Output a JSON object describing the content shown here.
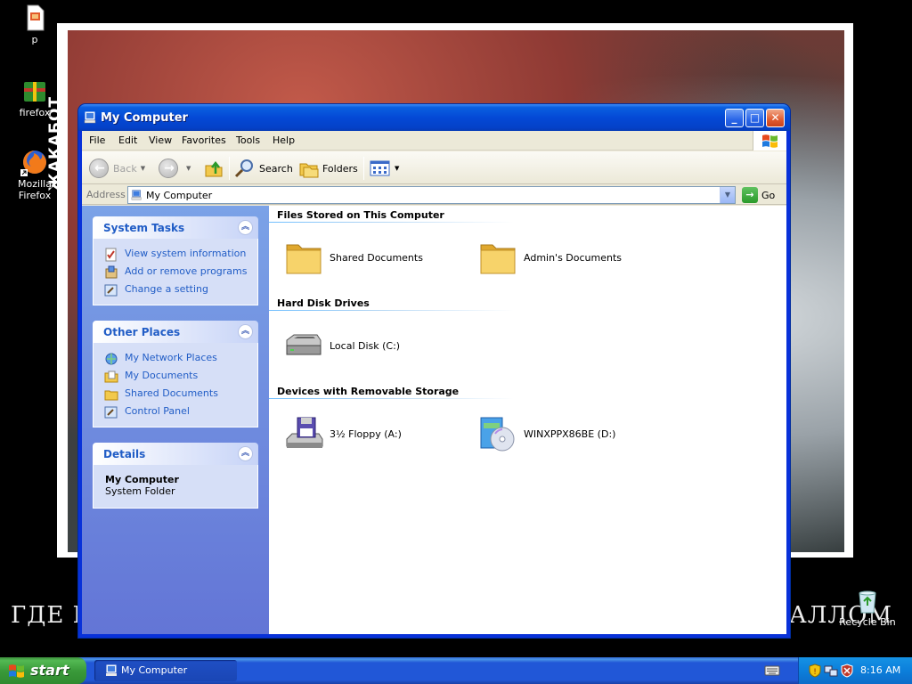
{
  "desktop": {
    "icons": [
      {
        "label": "p"
      },
      {
        "label": "firefox"
      },
      {
        "label": "Mozilla Firefox"
      },
      {
        "label": "Recycle Bin"
      }
    ],
    "wallpaper_text_vertical": "ЖАКАБОТ",
    "wallpaper_text_left": "ГДЕ М",
    "wallpaper_text_right": "АЛЛОМ"
  },
  "window": {
    "title": "My Computer",
    "menu": [
      "File",
      "Edit",
      "View",
      "Favorites",
      "Tools",
      "Help"
    ],
    "toolbar": {
      "back": "Back",
      "search": "Search",
      "folders": "Folders"
    },
    "address": {
      "label": "Address",
      "value": "My Computer",
      "go": "Go"
    },
    "taskpane": {
      "system_tasks": {
        "title": "System Tasks",
        "links": [
          "View system information",
          "Add or remove programs",
          "Change a setting"
        ]
      },
      "other_places": {
        "title": "Other Places",
        "links": [
          "My Network Places",
          "My Documents",
          "Shared Documents",
          "Control Panel"
        ]
      },
      "details": {
        "title": "Details",
        "name": "My Computer",
        "type": "System Folder"
      }
    },
    "groups": [
      {
        "title": "Files Stored on This Computer",
        "items": [
          "Shared Documents",
          "Admin's Documents"
        ]
      },
      {
        "title": "Hard Disk Drives",
        "items": [
          "Local Disk (C:)"
        ]
      },
      {
        "title": "Devices with Removable Storage",
        "items": [
          "3½ Floppy (A:)",
          "WINXPPX86BE (D:)"
        ]
      }
    ]
  },
  "taskbar": {
    "start": "start",
    "task_button": "My Computer",
    "clock": "8:16 AM"
  },
  "colors": {
    "xp_blue": "#0831d9",
    "link_blue": "#215dc6",
    "start_green": "#3a9a3a"
  }
}
